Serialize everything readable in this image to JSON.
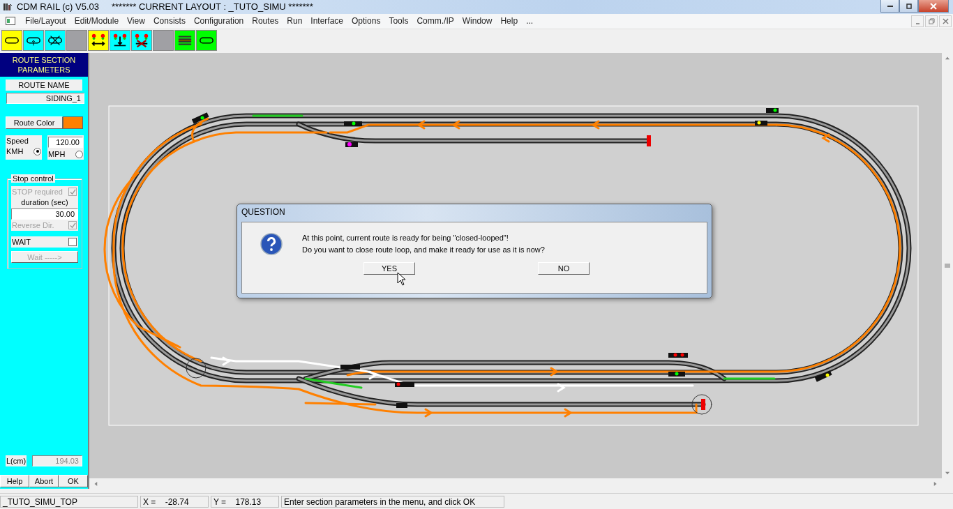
{
  "window": {
    "title": "CDM RAIL (c) V5.03",
    "layout_title": "******* CURRENT LAYOUT : _TUTO_SIMU *******"
  },
  "menu": [
    "File/Layout",
    "Edit/Module",
    "View",
    "Consists",
    "Configuration",
    "Routes",
    "Run",
    "Interface",
    "Options",
    "Tools",
    "Comm./IP",
    "Window",
    "Help",
    "..."
  ],
  "toolbar": [
    {
      "kind": "loop",
      "color": "#ffff00"
    },
    {
      "kind": "loop-arrow",
      "color": "#00ffff"
    },
    {
      "kind": "loop-cross",
      "color": "#00ffff"
    },
    {
      "kind": "blank",
      "color": "#a0a0a4"
    },
    {
      "kind": "signals-arrow",
      "color": "#ffff00"
    },
    {
      "kind": "signals-down",
      "color": "#00ffff"
    },
    {
      "kind": "signals-cross",
      "color": "#00ffff"
    },
    {
      "kind": "blank",
      "color": "#a0a0a4"
    },
    {
      "kind": "lines",
      "color": "#00ff00"
    },
    {
      "kind": "loop",
      "color": "#00ff00"
    }
  ],
  "panel": {
    "title": "ROUTE SECTION PARAMETERS",
    "route_name_label": "ROUTE NAME",
    "route_name": "SIDING_1",
    "route_color": {
      "label": "Route Color",
      "color": "#ff8000"
    },
    "speed_label": "Speed",
    "speed": "120.00",
    "units": [
      {
        "label": "KMH",
        "selected": true
      },
      {
        "label": "MPH",
        "selected": false
      }
    ],
    "stop_control": {
      "legend": "Stop control",
      "stop_required": {
        "label": "STOP required",
        "checked": true,
        "disabled": true
      },
      "duration_label": "duration (sec)",
      "duration": "30.00",
      "reverse": {
        "label": "Reverse Dir.",
        "checked": true,
        "disabled": true
      },
      "wait": {
        "label": "WAIT",
        "checked": false,
        "disabled": false
      },
      "wait_button": {
        "label": "Wait ----->",
        "disabled": true
      }
    },
    "length_label": "L(cm)",
    "length": "194.03",
    "buttons": [
      "Help",
      "Abort",
      "OK"
    ]
  },
  "dialog": {
    "title": "QUESTION",
    "lines": [
      "At this point, current route is ready for being \"closed-looped\"!",
      "Do you want to close route loop, and make it ready for use as it is now?"
    ],
    "buttons": [
      "YES",
      "NO"
    ]
  },
  "status_bar": [
    "_TUTO_SIMU_TOP",
    "X =    -28.74",
    "Y =    178.13",
    "Enter section parameters in the menu, and click OK"
  ]
}
